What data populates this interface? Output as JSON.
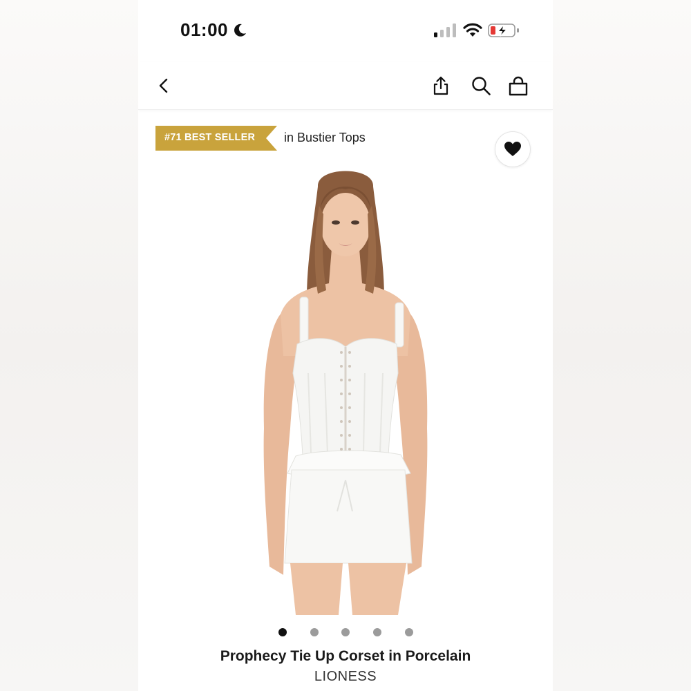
{
  "status_bar": {
    "time": "01:00",
    "icons": [
      "moon-icon",
      "cellular-signal-icon",
      "wifi-icon",
      "battery-charging-icon"
    ]
  },
  "nav": {
    "icons": [
      "chevron-left-icon",
      "share-icon",
      "search-icon",
      "shopping-bag-icon"
    ]
  },
  "badge": {
    "label": "#71 BEST SELLER",
    "category": "in Bustier Tops",
    "color": "#c9a33c"
  },
  "wishlist": {
    "icon": "heart-icon",
    "active": true
  },
  "carousel": {
    "total": 5,
    "active_index": 0
  },
  "product": {
    "title": "Prophecy Tie Up Corset in Porcelain",
    "brand": "LIONESS"
  },
  "colors": {
    "text_primary": "#1a1a1a",
    "dot_inactive": "#9b9b9b",
    "dot_active": "#111111"
  }
}
